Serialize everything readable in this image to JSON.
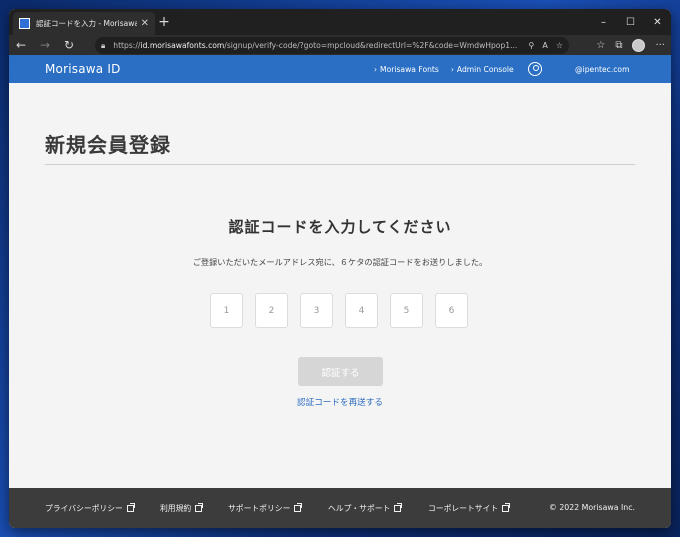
{
  "browser": {
    "tab_title": "認証コードを入力 - Morisawa ID",
    "tab_close": "✕",
    "new_tab": "+",
    "url_prefix": "https://",
    "url_host": "id.morisawafonts.com",
    "url_path": "/signup/verify-code/?goto=mpcloud&redirectUrl=%2F&code=WmdwHpop1...",
    "window_controls": [
      "–",
      "☐",
      "✕"
    ]
  },
  "site": {
    "brand": "Morisawa ID",
    "nav": [
      {
        "label": "Morisawa Fonts"
      },
      {
        "label": "Admin Console"
      }
    ],
    "email": "@ipentec.com"
  },
  "main": {
    "page_title": "新規会員登録",
    "heading": "認証コードを入力してください",
    "description": "ご登録いただいたメールアドレス宛に、６ケタの認証コードをお送りしました。",
    "code_placeholders": [
      "1",
      "2",
      "3",
      "4",
      "5",
      "6"
    ],
    "verify_button": "認証する",
    "resend_link": "認証コードを再送する"
  },
  "footer": {
    "links": [
      {
        "label": "プライバシーポリシー"
      },
      {
        "label": "利用規約"
      },
      {
        "label": "サポートポリシー"
      },
      {
        "label": "ヘルプ・サポート"
      },
      {
        "label": "コーポレートサイト"
      }
    ],
    "copyright": "© 2022 Morisawa Inc."
  },
  "colors": {
    "header_blue": "#2a6fc4",
    "link_blue": "#2d6cc0",
    "footer_bg": "#3c3c3c",
    "button_disabled": "#d6d6d6"
  }
}
